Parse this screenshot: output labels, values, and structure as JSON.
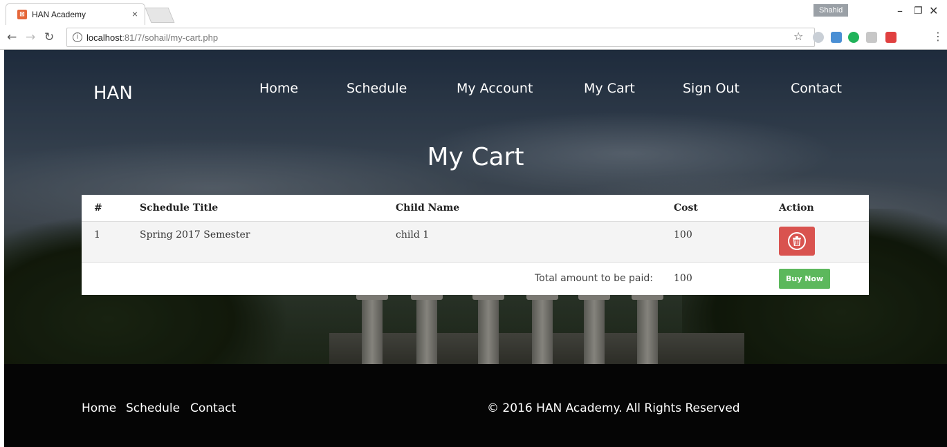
{
  "browser": {
    "tab_title": "HAN Academy",
    "tab_close": "×",
    "favicon_glyph": "⊠",
    "user_name": "Shahid",
    "url_host": "localhost",
    "url_path": ":81/7/sohail/my-cart.php",
    "icons": [
      "back-icon",
      "forward-icon",
      "reload-icon",
      "info-icon",
      "star-icon",
      "extension-icons",
      "menu-icon"
    ]
  },
  "site": {
    "brand": "HAN",
    "nav": [
      "Home",
      "Schedule",
      "My Account",
      "My Cart",
      "Sign Out",
      "Contact"
    ],
    "page_title": "My Cart"
  },
  "cart": {
    "headers": [
      "#",
      "Schedule Title",
      "Child Name",
      "Cost",
      "Action"
    ],
    "rows": [
      {
        "num": "1",
        "title": "Spring 2017 Semester",
        "child": "child 1",
        "cost": "100",
        "action": "delete"
      }
    ],
    "total_label": "Total amount to be paid:",
    "total_value": "100",
    "buy_label": "Buy Now"
  },
  "footer": {
    "links": [
      "Home",
      "Schedule",
      "Contact"
    ],
    "copyright": "© 2016 HAN Academy. All Rights Reserved"
  },
  "colors": {
    "delete_button": "#d9534f",
    "buy_button": "#5cb85c",
    "footer_bg": "#050505"
  }
}
